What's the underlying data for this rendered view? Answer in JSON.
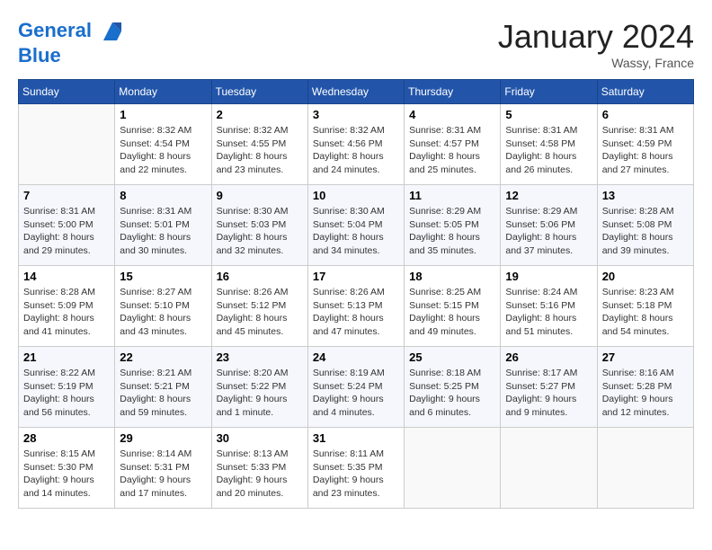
{
  "header": {
    "logo_line1": "General",
    "logo_line2": "Blue",
    "month": "January 2024",
    "location": "Wassy, France"
  },
  "weekdays": [
    "Sunday",
    "Monday",
    "Tuesday",
    "Wednesday",
    "Thursday",
    "Friday",
    "Saturday"
  ],
  "weeks": [
    [
      {
        "day": "",
        "info": ""
      },
      {
        "day": "1",
        "info": "Sunrise: 8:32 AM\nSunset: 4:54 PM\nDaylight: 8 hours\nand 22 minutes."
      },
      {
        "day": "2",
        "info": "Sunrise: 8:32 AM\nSunset: 4:55 PM\nDaylight: 8 hours\nand 23 minutes."
      },
      {
        "day": "3",
        "info": "Sunrise: 8:32 AM\nSunset: 4:56 PM\nDaylight: 8 hours\nand 24 minutes."
      },
      {
        "day": "4",
        "info": "Sunrise: 8:31 AM\nSunset: 4:57 PM\nDaylight: 8 hours\nand 25 minutes."
      },
      {
        "day": "5",
        "info": "Sunrise: 8:31 AM\nSunset: 4:58 PM\nDaylight: 8 hours\nand 26 minutes."
      },
      {
        "day": "6",
        "info": "Sunrise: 8:31 AM\nSunset: 4:59 PM\nDaylight: 8 hours\nand 27 minutes."
      }
    ],
    [
      {
        "day": "7",
        "info": "Sunrise: 8:31 AM\nSunset: 5:00 PM\nDaylight: 8 hours\nand 29 minutes."
      },
      {
        "day": "8",
        "info": "Sunrise: 8:31 AM\nSunset: 5:01 PM\nDaylight: 8 hours\nand 30 minutes."
      },
      {
        "day": "9",
        "info": "Sunrise: 8:30 AM\nSunset: 5:03 PM\nDaylight: 8 hours\nand 32 minutes."
      },
      {
        "day": "10",
        "info": "Sunrise: 8:30 AM\nSunset: 5:04 PM\nDaylight: 8 hours\nand 34 minutes."
      },
      {
        "day": "11",
        "info": "Sunrise: 8:29 AM\nSunset: 5:05 PM\nDaylight: 8 hours\nand 35 minutes."
      },
      {
        "day": "12",
        "info": "Sunrise: 8:29 AM\nSunset: 5:06 PM\nDaylight: 8 hours\nand 37 minutes."
      },
      {
        "day": "13",
        "info": "Sunrise: 8:28 AM\nSunset: 5:08 PM\nDaylight: 8 hours\nand 39 minutes."
      }
    ],
    [
      {
        "day": "14",
        "info": "Sunrise: 8:28 AM\nSunset: 5:09 PM\nDaylight: 8 hours\nand 41 minutes."
      },
      {
        "day": "15",
        "info": "Sunrise: 8:27 AM\nSunset: 5:10 PM\nDaylight: 8 hours\nand 43 minutes."
      },
      {
        "day": "16",
        "info": "Sunrise: 8:26 AM\nSunset: 5:12 PM\nDaylight: 8 hours\nand 45 minutes."
      },
      {
        "day": "17",
        "info": "Sunrise: 8:26 AM\nSunset: 5:13 PM\nDaylight: 8 hours\nand 47 minutes."
      },
      {
        "day": "18",
        "info": "Sunrise: 8:25 AM\nSunset: 5:15 PM\nDaylight: 8 hours\nand 49 minutes."
      },
      {
        "day": "19",
        "info": "Sunrise: 8:24 AM\nSunset: 5:16 PM\nDaylight: 8 hours\nand 51 minutes."
      },
      {
        "day": "20",
        "info": "Sunrise: 8:23 AM\nSunset: 5:18 PM\nDaylight: 8 hours\nand 54 minutes."
      }
    ],
    [
      {
        "day": "21",
        "info": "Sunrise: 8:22 AM\nSunset: 5:19 PM\nDaylight: 8 hours\nand 56 minutes."
      },
      {
        "day": "22",
        "info": "Sunrise: 8:21 AM\nSunset: 5:21 PM\nDaylight: 8 hours\nand 59 minutes."
      },
      {
        "day": "23",
        "info": "Sunrise: 8:20 AM\nSunset: 5:22 PM\nDaylight: 9 hours\nand 1 minute."
      },
      {
        "day": "24",
        "info": "Sunrise: 8:19 AM\nSunset: 5:24 PM\nDaylight: 9 hours\nand 4 minutes."
      },
      {
        "day": "25",
        "info": "Sunrise: 8:18 AM\nSunset: 5:25 PM\nDaylight: 9 hours\nand 6 minutes."
      },
      {
        "day": "26",
        "info": "Sunrise: 8:17 AM\nSunset: 5:27 PM\nDaylight: 9 hours\nand 9 minutes."
      },
      {
        "day": "27",
        "info": "Sunrise: 8:16 AM\nSunset: 5:28 PM\nDaylight: 9 hours\nand 12 minutes."
      }
    ],
    [
      {
        "day": "28",
        "info": "Sunrise: 8:15 AM\nSunset: 5:30 PM\nDaylight: 9 hours\nand 14 minutes."
      },
      {
        "day": "29",
        "info": "Sunrise: 8:14 AM\nSunset: 5:31 PM\nDaylight: 9 hours\nand 17 minutes."
      },
      {
        "day": "30",
        "info": "Sunrise: 8:13 AM\nSunset: 5:33 PM\nDaylight: 9 hours\nand 20 minutes."
      },
      {
        "day": "31",
        "info": "Sunrise: 8:11 AM\nSunset: 5:35 PM\nDaylight: 9 hours\nand 23 minutes."
      },
      {
        "day": "",
        "info": ""
      },
      {
        "day": "",
        "info": ""
      },
      {
        "day": "",
        "info": ""
      }
    ]
  ]
}
